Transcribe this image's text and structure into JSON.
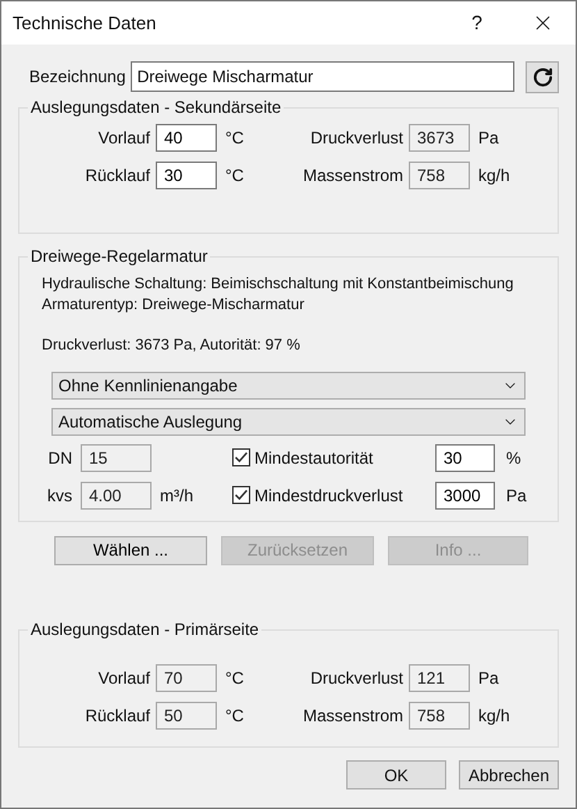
{
  "window": {
    "title": "Technische Daten",
    "help": "?"
  },
  "designation": {
    "label": "Bezeichnung",
    "value": "Dreiwege Mischarmatur"
  },
  "secondary": {
    "title": "Auslegungsdaten - Sekundärseite",
    "fields": [
      {
        "label": "Vorlauf",
        "value": "40",
        "unit": "°C",
        "readonly": false
      },
      {
        "label": "Druckverlust",
        "value": "3673",
        "unit": "Pa",
        "readonly": true
      },
      {
        "label": "Rücklauf",
        "value": "30",
        "unit": "°C",
        "readonly": false
      },
      {
        "label": "Massenstrom",
        "value": "758",
        "unit": "kg/h",
        "readonly": true
      }
    ]
  },
  "valve": {
    "title": "Dreiwege-Regelarmatur",
    "lines": [
      "Hydraulische Schaltung: Beimischschaltung mit Konstantbeimischung",
      "Armaturentyp: Dreiwege-Mischarmatur"
    ],
    "summary": "Druckverlust: 3673 Pa, Autorität: 97 %",
    "dropdowns": [
      "Ohne Kennlinienangabe",
      "Automatische Auslegung"
    ],
    "params": [
      {
        "label": "DN",
        "value": "15",
        "readonly": true
      },
      {
        "label": "kvs",
        "value": "4.00",
        "unit": "m³/h",
        "readonly": true
      }
    ],
    "limits": [
      {
        "label": "Mindestautorität",
        "checked": true,
        "value": "30",
        "unit": "%"
      },
      {
        "label": "Mindestdruckverlust",
        "checked": true,
        "value": "3000",
        "unit": "Pa"
      }
    ]
  },
  "actions": [
    {
      "label": "Wählen ...",
      "disabled": false
    },
    {
      "label": "Zurücksetzen",
      "disabled": true
    },
    {
      "label": "Info ...",
      "disabled": true
    }
  ],
  "primary": {
    "title": "Auslegungsdaten - Primärseite",
    "fields": [
      {
        "label": "Vorlauf",
        "value": "70",
        "unit": "°C",
        "readonly": true
      },
      {
        "label": "Druckverlust",
        "value": "121",
        "unit": "Pa",
        "readonly": true
      },
      {
        "label": "Rücklauf",
        "value": "50",
        "unit": "°C",
        "readonly": true
      },
      {
        "label": "Massenstrom",
        "value": "758",
        "unit": "kg/h",
        "readonly": true
      }
    ]
  },
  "footer": [
    "OK",
    "Abbrechen"
  ]
}
